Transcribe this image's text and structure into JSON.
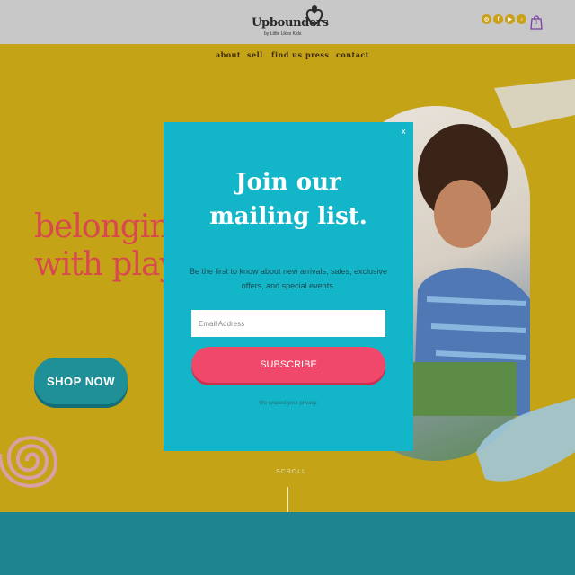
{
  "brand": {
    "name": "Upbounders",
    "tagline": "by Little Likes Kids"
  },
  "header": {
    "social_icons": [
      "instagram-icon",
      "facebook-icon",
      "youtube-icon",
      "tiktok-icon"
    ],
    "cart_icon": "shopping-bag-icon",
    "cart_count": "0"
  },
  "nav": {
    "items": [
      {
        "label": "about"
      },
      {
        "label": "sell"
      },
      {
        "label": "find us"
      },
      {
        "label": "press"
      },
      {
        "label": "contact"
      }
    ]
  },
  "hero": {
    "headline_line1": "belonging",
    "headline_line2": "with play",
    "cta_label": "SHOP NOW",
    "scroll_label": "SCROLL"
  },
  "popup": {
    "close_label": "x",
    "title": "Join our mailing list.",
    "description": "Be the first to know about new arrivals, sales, exclusive offers, and special events.",
    "email_placeholder": "Email Address",
    "subscribe_label": "SUBSCRIBE",
    "privacy_note": "We respect your privacy."
  },
  "colors": {
    "hero_background": "#c5a317",
    "header_background": "#c8c8c8",
    "headline": "#d8494f",
    "cta_button": "#1f8f98",
    "popup_background": "#13b6c8",
    "subscribe_button": "#f0486a",
    "footer_band": "#1e8590"
  }
}
